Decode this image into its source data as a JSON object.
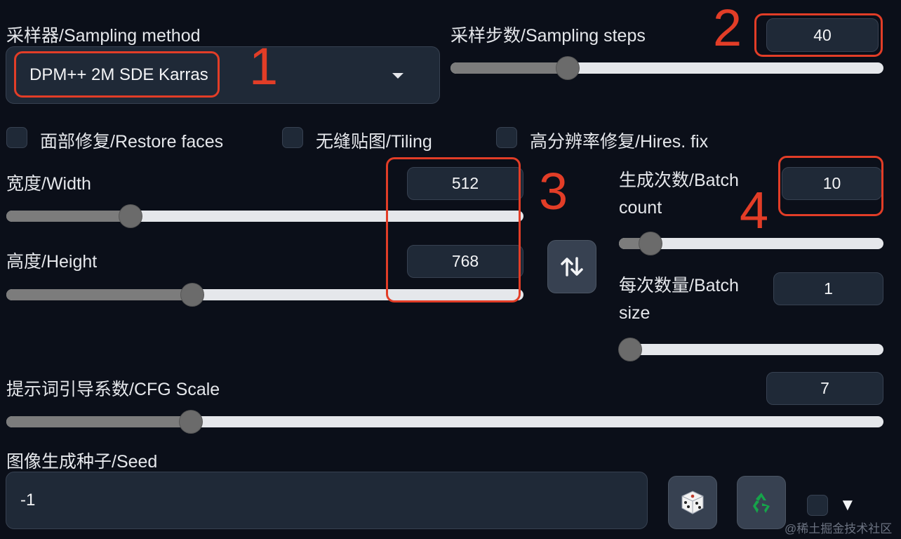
{
  "sampler": {
    "label": "采样器/Sampling method",
    "value": "DPM++ 2M SDE Karras",
    "marker": "1"
  },
  "steps": {
    "label": "采样步数/Sampling steps",
    "value": "40",
    "level": 0.27,
    "marker": "2"
  },
  "checkboxes": {
    "restore_faces": "面部修复/Restore faces",
    "tiling": "无缝贴图/Tiling",
    "hires_fix": "高分辨率修复/Hires. fix"
  },
  "width": {
    "label": "宽度/Width",
    "value": "512",
    "level": 0.24
  },
  "height": {
    "label": "高度/Height",
    "value": "768",
    "level": 0.36
  },
  "size_marker": "3",
  "swap_icon": "swap-arrows-icon",
  "batch_count": {
    "label": "生成次数/Batch count",
    "value": "10",
    "level": 0.12,
    "marker": "4"
  },
  "batch_size": {
    "label": "每次数量/Batch size",
    "value": "1",
    "level": 0.0
  },
  "cfg": {
    "label": "提示词引导系数/CFG Scale",
    "value": "7",
    "level": 0.21
  },
  "seed": {
    "label": "图像生成种子/Seed",
    "value": "-1",
    "random_icon": "dice-icon",
    "reuse_icon": "recycle-icon",
    "extra_toggle": "▼"
  },
  "watermark": "@稀土掘金技术社区",
  "colors": {
    "background": "#0b0f19",
    "input": "#1f2937",
    "annotation": "#e23d27"
  }
}
